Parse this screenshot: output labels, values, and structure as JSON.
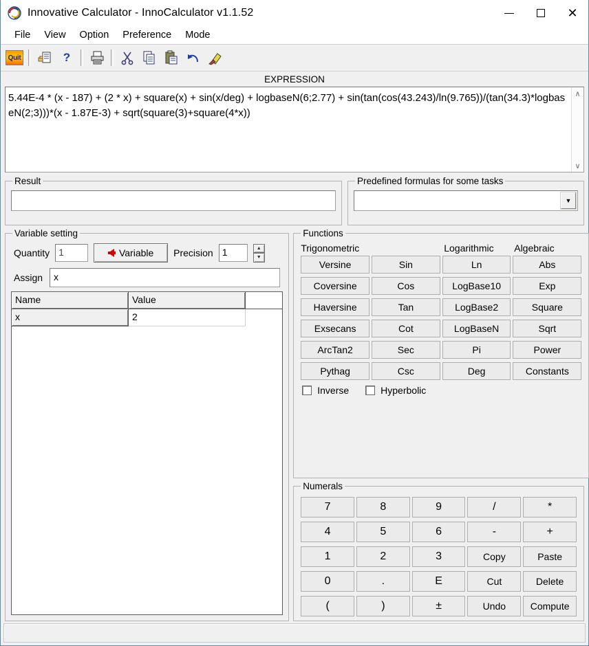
{
  "window": {
    "title": "Innovative Calculator - InnoCalculator v1.1.52",
    "icon": "app-logo-icon",
    "minimize": "—",
    "maximize": "□",
    "close": "✕"
  },
  "menubar": {
    "items": [
      {
        "label": "File"
      },
      {
        "label": "View"
      },
      {
        "label": "Option"
      },
      {
        "label": "Preference"
      },
      {
        "label": "Mode"
      }
    ]
  },
  "toolbar": {
    "quit_label": "Quit",
    "buttons": [
      {
        "name": "quit-button",
        "label": "Quit"
      },
      {
        "name": "insert-document-button",
        "label": ""
      },
      {
        "name": "help-button",
        "label": "?"
      },
      {
        "name": "print-button",
        "label": ""
      },
      {
        "name": "cut-button",
        "label": ""
      },
      {
        "name": "copy-button",
        "label": ""
      },
      {
        "name": "paste-button",
        "label": ""
      },
      {
        "name": "undo-button",
        "label": ""
      },
      {
        "name": "clear-all-button",
        "label": ""
      }
    ]
  },
  "expression": {
    "caption": "EXPRESSION",
    "value": "5.44E-4 * (x - 187) + (2 * x) + square(x) + sin(x/deg) + logbaseN(6;2.77) + sin(tan(cos(43.243)/ln(9.765))/(tan(34.3)*logbaseN(2;3)))*(x - 1.87E-3) + sqrt(square(3)+square(4*x))",
    "scroll_up": "∧",
    "scroll_down": "∨"
  },
  "result": {
    "legend": "Result",
    "value": "",
    "placeholder": ""
  },
  "predefined": {
    "legend": "Predefined formulas for some tasks",
    "selected": "",
    "options": []
  },
  "variable_setting": {
    "legend": "Variable setting",
    "quantity_label": "Quantity",
    "quantity_value": "1",
    "variable_button": "Variable",
    "precision_label": "Precision",
    "precision_value": "1",
    "spin_up": "▲",
    "spin_down": "▼",
    "assign_label": "Assign",
    "assign_value": "x",
    "grid": {
      "columns": [
        "Name",
        "Value"
      ],
      "rows": [
        {
          "name": "x",
          "value": "2"
        }
      ]
    }
  },
  "functions": {
    "legend": "Functions",
    "group_headers": [
      "Trigonometric",
      "",
      "Logarithmic",
      "Algebraic"
    ],
    "buttons": [
      "Versine",
      "Sin",
      "Ln",
      "Abs",
      "Coversine",
      "Cos",
      "LogBase10",
      "Exp",
      "Haversine",
      "Tan",
      "LogBase2",
      "Square",
      "Exsecans",
      "Cot",
      "LogBaseN",
      "Sqrt",
      "ArcTan2",
      "Sec",
      "Pi",
      "Power",
      "Pythag",
      "Csc",
      "Deg",
      "Constants"
    ],
    "inverse_label": "Inverse",
    "inverse_checked": false,
    "hyperbolic_label": "Hyperbolic",
    "hyperbolic_checked": false
  },
  "numerals": {
    "legend": "Numerals",
    "buttons": [
      "7",
      "8",
      "9",
      "/",
      "*",
      "4",
      "5",
      "6",
      "-",
      "+",
      "1",
      "2",
      "3",
      "Copy",
      "Paste",
      "0",
      ".",
      "E",
      "Cut",
      "Delete",
      "(",
      ")",
      "±",
      "Undo",
      "Compute"
    ]
  },
  "statusbar": {
    "text": ""
  },
  "colors": {
    "window_bg": "#f0f0f0",
    "accent_red": "#d40000",
    "quit_orange": "#ff9900",
    "border": "#b4b4b4"
  }
}
